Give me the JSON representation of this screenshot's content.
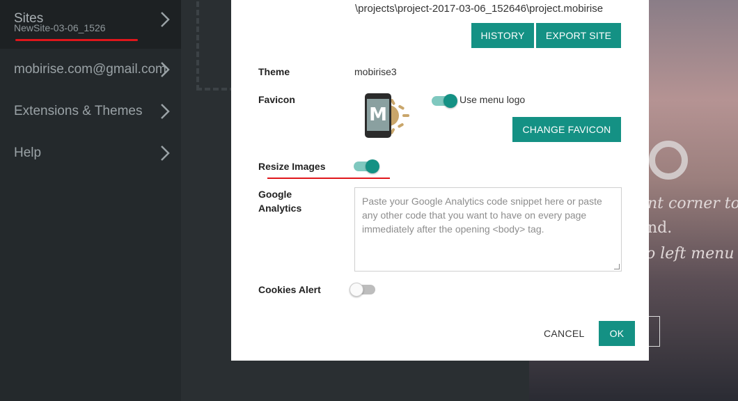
{
  "sidebar": {
    "items": [
      {
        "label": "Sites",
        "sub": "NewSite-03-06_1526"
      },
      {
        "label": "mobirise.com@gmail.com"
      },
      {
        "label": "Extensions & Themes"
      },
      {
        "label": "Help"
      }
    ]
  },
  "modal": {
    "project_path": "\\projects\\project-2017-03-06_152646\\project.mobirise",
    "history_label": "HISTORY",
    "export_label": "EXPORT SITE",
    "theme_label": "Theme",
    "theme_value": "mobirise3",
    "favicon_label": "Favicon",
    "use_menu_logo_label": "Use menu logo",
    "change_favicon_label": "CHANGE FAVICON",
    "resize_images_label": "Resize Images",
    "google_label_1": "Google",
    "google_label_2": "Analytics",
    "ga_placeholder": "Paste your Google Analytics code snippet here or paste any other code that you want to have on every page immediately after the opening <body> tag.",
    "cookies_label": "Cookies Alert",
    "cancel_label": "CANCEL",
    "ok_label": "OK",
    "toggles": {
      "use_menu_logo": true,
      "resize_images": true,
      "cookies_alert": false
    }
  },
  "background": {
    "text_1": "nt corner to",
    "text_2": "nd.",
    "text_3": "o left menu t"
  },
  "colors": {
    "accent": "#149184",
    "annotation": "#e0161b"
  }
}
